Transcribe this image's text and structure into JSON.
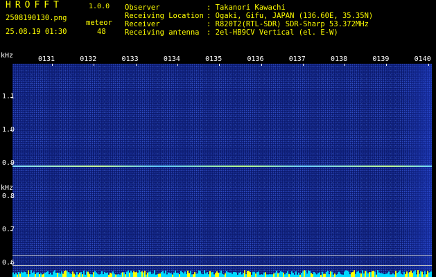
{
  "header": {
    "app_title": "HROFFT",
    "app_version": "1.0.0",
    "filename": "2508190130.png",
    "datetime": "25.08.19 01:30",
    "mode_label": "meteor",
    "mode_count": "48"
  },
  "info": [
    {
      "label": "Observer",
      "value": ": Takanori Kawachi"
    },
    {
      "label": "Receiving Location",
      "value": ": Ogaki, Gifu, JAPAN (136.60E, 35.35N)"
    },
    {
      "label": "Receiver",
      "value": ": R820T2(RTL-SDR) SDR-Sharp 53.372MHz"
    },
    {
      "label": "Receiving antenna",
      "value": ": 2el-HB9CV Vertical (el. E-W)"
    }
  ],
  "axis": {
    "unit_top": "kHz",
    "unit_mid": "kHz",
    "time_ticks": [
      "0131",
      "0132",
      "0133",
      "0134",
      "0135",
      "0136",
      "0137",
      "0138",
      "0139",
      "0140"
    ],
    "freq_ticks": [
      "1.1",
      "1.0",
      "0.9",
      "0.8",
      "0.7",
      "0.6"
    ],
    "freq_values": [
      1.1,
      1.0,
      0.9,
      0.8,
      0.7,
      0.6
    ],
    "freq_range": [
      0.58,
      1.2
    ],
    "carrier_freq": 0.893
  },
  "colors": {
    "header_yellow": "#ffff00",
    "header_white": "#ffffff",
    "background": "#000000",
    "spectrogram_blue": "#0b1a6e",
    "spectrum_cyan": "#00d8ff",
    "spectrum_yellow": "#ffff00"
  }
}
